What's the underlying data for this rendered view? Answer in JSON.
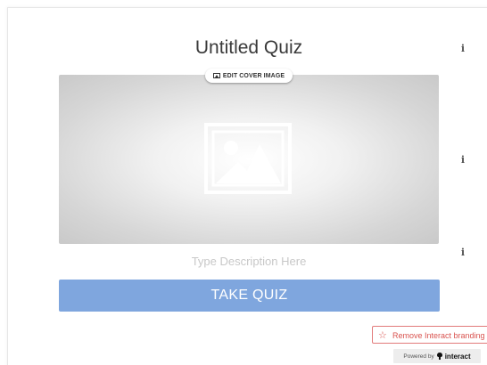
{
  "quiz": {
    "title": "Untitled Quiz",
    "description_placeholder": "Type Description Here",
    "take_quiz_label": "TAKE QUIZ"
  },
  "cover": {
    "edit_label": "EDIT COVER IMAGE",
    "placeholder_icon": "image-placeholder-icon"
  },
  "info_icon_glyph": "i",
  "branding": {
    "remove_label": "Remove Interact branding",
    "powered_by_label": "Powered by",
    "brand_name": "interact"
  },
  "colors": {
    "button_bg": "#7fa6de",
    "remove_branding": "#d9534f",
    "description_text": "#c8c8c8"
  }
}
